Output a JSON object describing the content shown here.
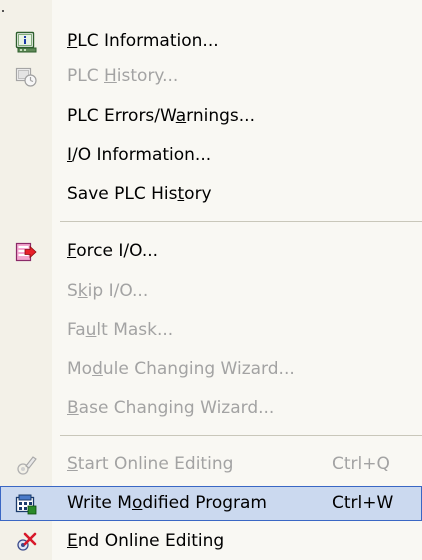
{
  "menu": {
    "items": [
      {
        "id": "plc-information",
        "label_pre": "",
        "mnemonic": "P",
        "label_post": "LC Information...",
        "shortcut": "",
        "enabled": true,
        "icon": "plc-info-icon"
      },
      {
        "id": "plc-history",
        "label_pre": "PLC ",
        "mnemonic": "H",
        "label_post": "istory...",
        "shortcut": "",
        "enabled": false,
        "icon": "plc-history-icon"
      },
      {
        "id": "plc-errors-warnings",
        "label_pre": "PLC Errors/W",
        "mnemonic": "a",
        "label_post": "rnings...",
        "shortcut": "",
        "enabled": true,
        "icon": ""
      },
      {
        "id": "io-information",
        "label_pre": "",
        "mnemonic": "I",
        "label_post": "/O Information...",
        "shortcut": "",
        "enabled": true,
        "icon": ""
      },
      {
        "id": "save-plc-history",
        "label_pre": "Save PLC His",
        "mnemonic": "t",
        "label_post": "ory",
        "shortcut": "",
        "enabled": true,
        "icon": ""
      },
      {
        "id": "force-io",
        "label_pre": "",
        "mnemonic": "F",
        "label_post": "orce I/O...",
        "shortcut": "",
        "enabled": true,
        "icon": "force-io-icon"
      },
      {
        "id": "skip-io",
        "label_pre": "S",
        "mnemonic": "k",
        "label_post": "ip I/O...",
        "shortcut": "",
        "enabled": false,
        "icon": ""
      },
      {
        "id": "fault-mask",
        "label_pre": "Fa",
        "mnemonic": "u",
        "label_post": "lt Mask...",
        "shortcut": "",
        "enabled": false,
        "icon": ""
      },
      {
        "id": "module-changing-wizard",
        "label_pre": "Mo",
        "mnemonic": "d",
        "label_post": "ule Changing Wizard...",
        "shortcut": "",
        "enabled": false,
        "icon": ""
      },
      {
        "id": "base-changing-wizard",
        "label_pre": "",
        "mnemonic": "B",
        "label_post": "ase Changing Wizard...",
        "shortcut": "",
        "enabled": false,
        "icon": ""
      },
      {
        "id": "start-online-editing",
        "label_pre": "",
        "mnemonic": "S",
        "label_post": "tart Online Editing",
        "shortcut": "Ctrl+Q",
        "enabled": false,
        "icon": "start-online-editing-icon"
      },
      {
        "id": "write-modified-program",
        "label_pre": "Write M",
        "mnemonic": "o",
        "label_post": "dified Program",
        "shortcut": "Ctrl+W",
        "enabled": true,
        "highlighted": true,
        "icon": "write-modified-program-icon"
      },
      {
        "id": "end-online-editing",
        "label_pre": "",
        "mnemonic": "E",
        "label_post": "nd Online Editing",
        "shortcut": "",
        "enabled": true,
        "icon": "end-online-editing-icon"
      }
    ]
  },
  "colors": {
    "menu_background": "#f9f8f3",
    "gutter_background": "#f3f1e8",
    "disabled_text": "#a3a3a3",
    "highlight_fill": "#cbd9ef",
    "highlight_border": "#3a67c4"
  }
}
